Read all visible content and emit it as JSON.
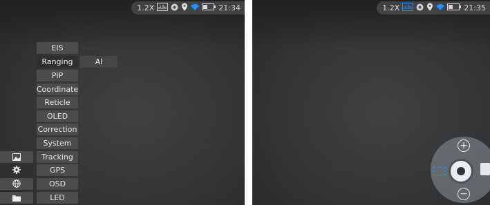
{
  "left_screen": {
    "status": {
      "zoom": "1.2X",
      "time": "21:34"
    },
    "menu": {
      "items": [
        "EIS",
        "Ranging",
        "PIP",
        "Coordinate",
        "Reticle",
        "OLED",
        "Correction",
        "System",
        "Tracking",
        "GPS",
        "OSD",
        "LED"
      ],
      "selected": "Ranging"
    },
    "submenu": {
      "items": [
        "AI"
      ]
    },
    "side_buttons": [
      "image-icon",
      "gear-icon",
      "globe-icon",
      "folder-icon"
    ]
  },
  "right_screen": {
    "status": {
      "zoom": "1.2X",
      "time": "21:35"
    },
    "wheel": {
      "zoom_in_symbol": "+",
      "zoom_out_symbol": "−"
    }
  },
  "colors": {
    "accent_blue": "#1e90ff",
    "menu_bg": "#4a4c4e",
    "menu_selected": "#2d2f30"
  }
}
